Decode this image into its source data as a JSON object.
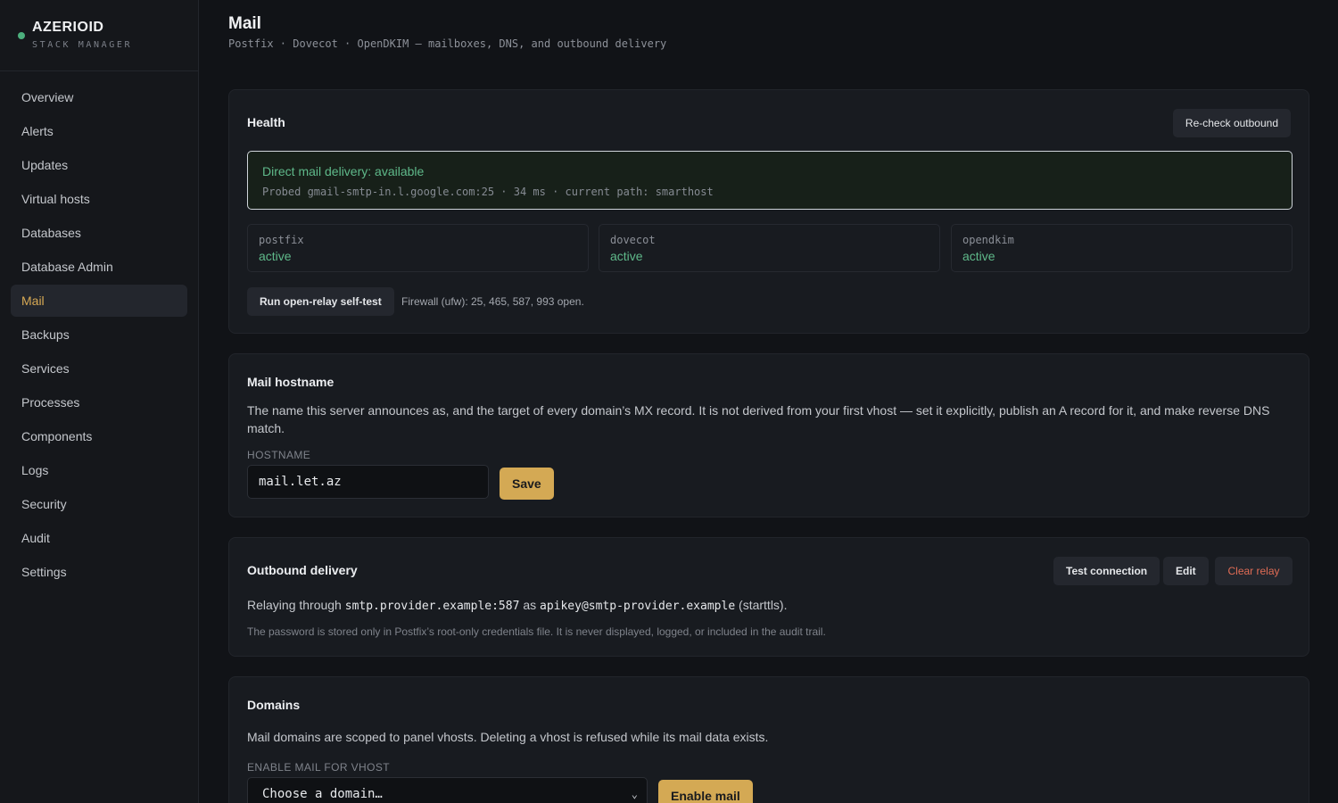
{
  "brand": {
    "name": "AZERIOID",
    "subtitle": "STACK MANAGER",
    "status_color": "#4caf7d"
  },
  "sidebar": {
    "items": [
      {
        "label": "Overview"
      },
      {
        "label": "Alerts"
      },
      {
        "label": "Updates"
      },
      {
        "label": "Virtual hosts"
      },
      {
        "label": "Databases"
      },
      {
        "label": "Database Admin"
      },
      {
        "label": "Mail",
        "active": true
      },
      {
        "label": "Backups"
      },
      {
        "label": "Services"
      },
      {
        "label": "Processes"
      },
      {
        "label": "Components"
      },
      {
        "label": "Logs"
      },
      {
        "label": "Security"
      },
      {
        "label": "Audit"
      },
      {
        "label": "Settings"
      }
    ]
  },
  "page": {
    "title": "Mail",
    "subtitle": "Postfix · Dovecot · OpenDKIM — mailboxes, DNS, and outbound delivery"
  },
  "health": {
    "title": "Health",
    "recheck_label": "Re-check outbound",
    "status_head": "Direct mail delivery: available",
    "status_detail": "Probed gmail-smtp-in.l.google.com:25 · 34 ms · current path: smarthost",
    "services": [
      {
        "name": "postfix",
        "state": "active"
      },
      {
        "name": "dovecot",
        "state": "active"
      },
      {
        "name": "opendkim",
        "state": "active"
      }
    ],
    "relay_test_label": "Run open-relay self-test",
    "firewall_text": "Firewall (ufw): 25, 465, 587, 993 open."
  },
  "hostname": {
    "title": "Mail hostname",
    "description": "The name this server announces as, and the target of every domain’s MX record. It is not derived from your first vhost — set it explicitly, publish an A record for it, and make reverse DNS match.",
    "field_label": "HOSTNAME",
    "value": "mail.let.az",
    "save_label": "Save"
  },
  "outbound": {
    "title": "Outbound delivery",
    "test_label": "Test connection",
    "edit_label": "Edit",
    "clear_label": "Clear relay",
    "relay_prefix": "Relaying through",
    "relay_host": "smtp.provider.example:587",
    "relay_as": "as",
    "relay_user": "apikey@smtp-provider.example",
    "relay_suffix": "(starttls).",
    "note": "The password is stored only in Postfix’s root-only credentials file. It is never displayed, logged, or included in the audit trail."
  },
  "domains": {
    "title": "Domains",
    "description": "Mail domains are scoped to panel vhosts. Deleting a vhost is refused while its mail data exists.",
    "field_label": "ENABLE MAIL FOR VHOST",
    "select_value": "Choose a domain…",
    "enable_label": "Enable mail"
  }
}
